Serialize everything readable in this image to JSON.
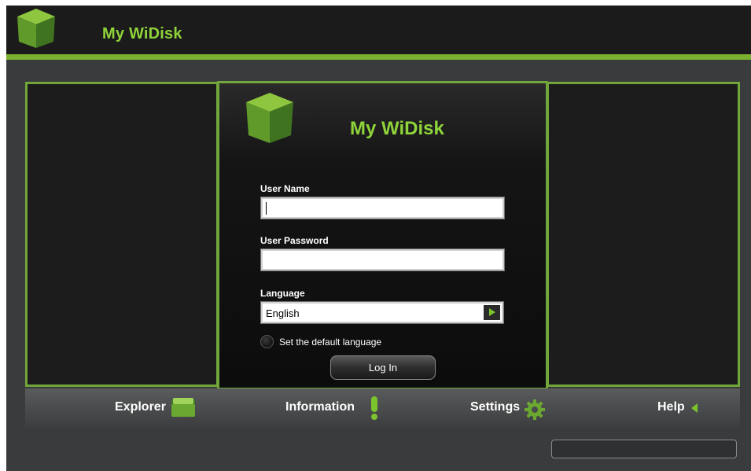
{
  "header": {
    "title": "My WiDisk"
  },
  "login": {
    "title": "My WiDisk",
    "username_label": "User Name",
    "username_value": "",
    "password_label": "User Password",
    "password_value": "",
    "language_label": "Language",
    "language_selected": "English",
    "default_language_label": "Set the default language",
    "login_button": "Log In"
  },
  "nav": {
    "explorer": "Explorer",
    "information": "Information",
    "settings": "Settings",
    "help": "Help"
  },
  "icons": {
    "logo": "cube-logo-icon",
    "explorer": "folder-icon",
    "information": "exclamation-icon",
    "settings": "gear-icon",
    "help": "chevron-left-icon",
    "language": "play-arrow-icon"
  },
  "colors": {
    "accent": "#7cb230",
    "title_green": "#8fd43a"
  }
}
